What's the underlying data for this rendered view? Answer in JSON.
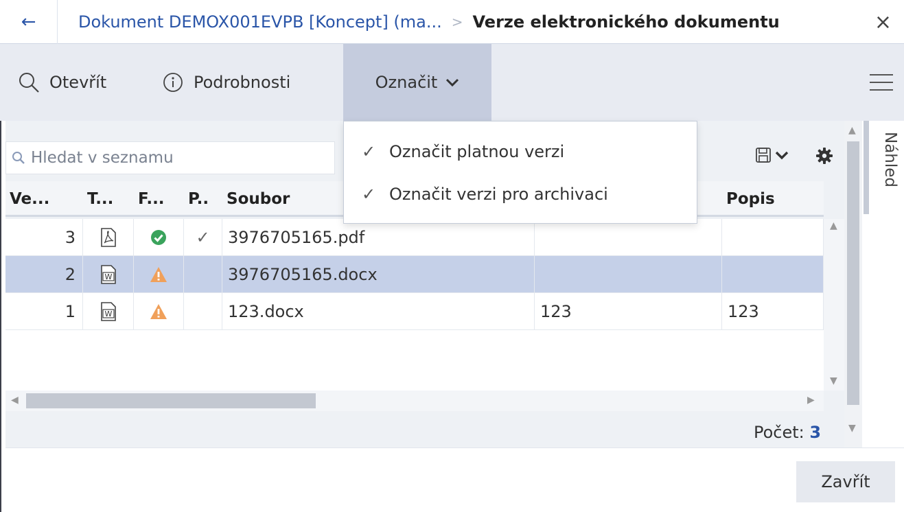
{
  "titlebar": {
    "back_icon": "arrow-left-icon",
    "breadcrumb_parent": "Dokument DEMOX001EVPB [Koncept] (ma...",
    "breadcrumb_separator": ">",
    "breadcrumb_current": "Verze elektronického dokumentu",
    "close_icon": "close-icon"
  },
  "toolbar": {
    "open_label": "Otevřít",
    "details_label": "Podrobnosti",
    "mark_label": "Označit"
  },
  "dropdown": {
    "items": [
      {
        "label": "Označit platnou verzi"
      },
      {
        "label": "Označit verzi pro archivaci"
      }
    ]
  },
  "search": {
    "placeholder": "Hledat v seznamu"
  },
  "table": {
    "columns": [
      "Ve...",
      "T...",
      "F...",
      "P..",
      "Soubor",
      "",
      "Popis"
    ],
    "rows": [
      {
        "version": "3",
        "type_icon": "pdf-file-icon",
        "format_icon": "check-circle-icon",
        "valid": "✓",
        "file": "3976705165.pdf",
        "note": "",
        "description": "",
        "selected": false
      },
      {
        "version": "2",
        "type_icon": "word-file-icon",
        "format_icon": "warning-icon",
        "valid": "",
        "file": "3976705165.docx",
        "note": "",
        "description": "",
        "selected": true
      },
      {
        "version": "1",
        "type_icon": "word-file-icon",
        "format_icon": "warning-icon",
        "valid": "",
        "file": "123.docx",
        "note": "123",
        "description": "123",
        "selected": false
      }
    ]
  },
  "footer": {
    "count_label": "Počet:",
    "count_value": "3",
    "close_label": "Zavřít"
  },
  "side_panel": {
    "label": "Náhled"
  },
  "colors": {
    "accent": "#2a55a8",
    "toolbar_bg": "#e8ebf2",
    "selected_row": "#c5d0e8",
    "success": "#3aa35c",
    "warning": "#f0a05a"
  }
}
